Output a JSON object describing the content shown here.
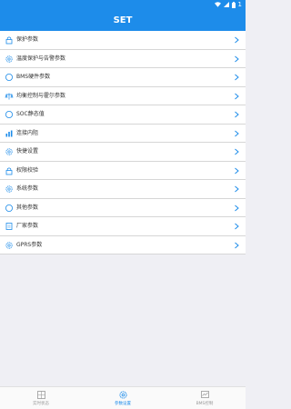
{
  "status_bar": {
    "battery_level": "1"
  },
  "header": {
    "title": "SET"
  },
  "menu": [
    {
      "label": "保护参数",
      "icon": "lock-icon"
    },
    {
      "label": "温度保护与告警参数",
      "icon": "gear-icon"
    },
    {
      "label": "BMS硬件参数",
      "icon": "circle-icon"
    },
    {
      "label": "均衡控制与霍尔参数",
      "icon": "balance-icon"
    },
    {
      "label": "SOC静态值",
      "icon": "circle-icon"
    },
    {
      "label": "连接内阻",
      "icon": "bar-chart-icon"
    },
    {
      "label": "快捷设置",
      "icon": "gear-icon"
    },
    {
      "label": "权限校验",
      "icon": "lock-icon"
    },
    {
      "label": "系统参数",
      "icon": "gear-icon"
    },
    {
      "label": "其他参数",
      "icon": "circle-icon"
    },
    {
      "label": "厂家参数",
      "icon": "doc-icon"
    },
    {
      "label": "GPRS参数",
      "icon": "gear-icon"
    }
  ],
  "tabs": [
    {
      "label": "实时状态",
      "icon": "grid-icon",
      "active": false
    },
    {
      "label": "参数设置",
      "icon": "gear-icon",
      "active": true
    },
    {
      "label": "BMS控制",
      "icon": "chart-icon",
      "active": false
    }
  ],
  "colors": {
    "primary": "#1d8cea",
    "background": "#efeff4",
    "inactive": "#999999"
  }
}
